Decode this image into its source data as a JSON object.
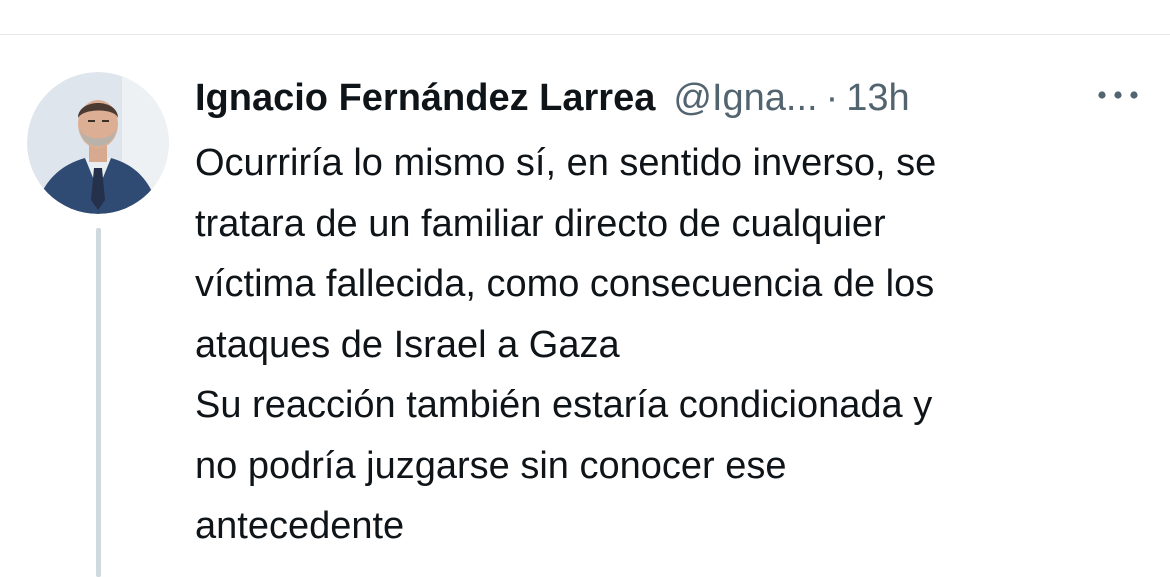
{
  "tweet": {
    "author_name": "Ignacio Fernández Larrea",
    "author_handle": "@Igna...",
    "separator": "·",
    "timestamp": "13h",
    "text_lines": [
      "Ocurriría lo mismo sí, en sentido inverso, se",
      "tratara de un familiar directo de cualquier",
      "víctima fallecida, como consecuencia de los",
      "ataques de Israel a Gaza",
      "Su reacción también estaría condicionada y",
      "no podría juzgarse sin conocer ese",
      "antecedente"
    ]
  },
  "icons": {
    "more": "more-horizontal-icon",
    "avatar": "profile-photo"
  },
  "colors": {
    "text_primary": "#0f1419",
    "text_secondary": "#536471",
    "thread_line": "#cfd9de",
    "divider": "#e6e9ec",
    "background": "#ffffff"
  }
}
